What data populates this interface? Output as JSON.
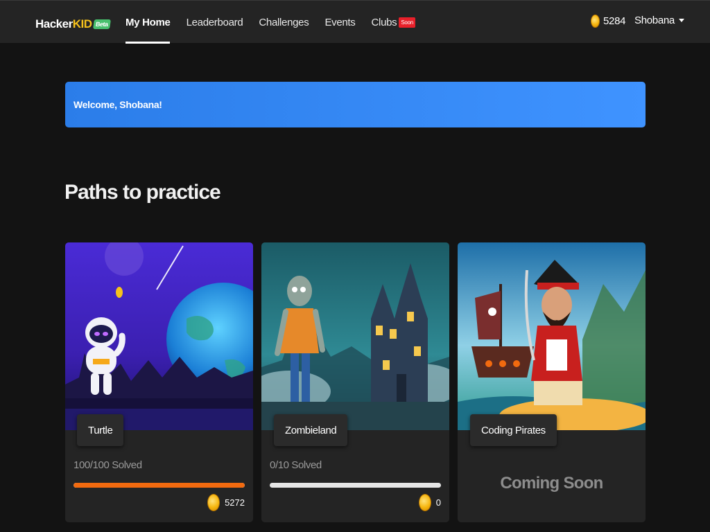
{
  "header": {
    "logo": {
      "hacker": "Hacker",
      "kid": "KID",
      "beta": "Beta"
    },
    "nav": [
      {
        "label": "My Home",
        "active": true
      },
      {
        "label": "Leaderboard"
      },
      {
        "label": "Challenges"
      },
      {
        "label": "Events"
      },
      {
        "label": "Clubs",
        "badge": "Soon"
      }
    ],
    "coins": "5284",
    "user": "Shobana"
  },
  "welcome": "Welcome, Shobana!",
  "section_title": "Paths to practice",
  "cards": [
    {
      "title": "Turtle",
      "solved": "100/100 Solved",
      "progress": 1.0,
      "coins": "5272"
    },
    {
      "title": "Zombieland",
      "solved": "0/10 Solved",
      "progress": 0.0,
      "coins": "0"
    },
    {
      "title": "Coding Pirates",
      "status": "Coming Soon"
    }
  ],
  "colors": {
    "background": "#131313",
    "topbar": "#242424",
    "banner": "#3388f5",
    "progress_fill": "#f26a0f",
    "coin": "#f6b60f",
    "soon_badge": "#e8202a"
  }
}
